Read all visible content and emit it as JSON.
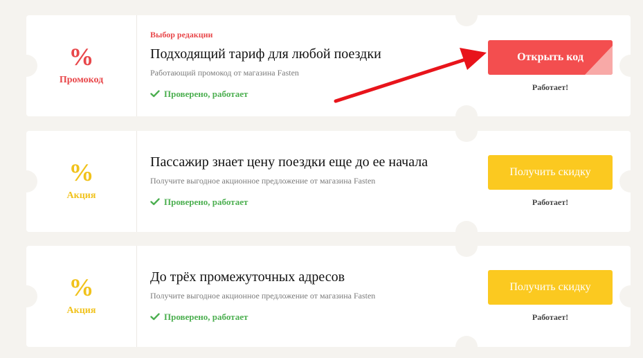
{
  "coupons": [
    {
      "percent": "%",
      "type": "Промокод",
      "editor_label": "Выбор редакции",
      "title": "Подходящий тариф для любой поездки",
      "subtitle": "Работающий промокод от магазина Fasten",
      "verified": "Проверено, работает",
      "button": "Открыть код",
      "status": "Работает!"
    },
    {
      "percent": "%",
      "type": "Акция",
      "title": "Пассажир знает цену поездки еще до ее начала",
      "subtitle": "Получите выгодное акционное предложение от магазина Fasten",
      "verified": "Проверено, работает",
      "button": "Получить скидку",
      "status": "Работает!"
    },
    {
      "percent": "%",
      "type": "Акция",
      "title": "До трёх промежуточных адресов",
      "subtitle": "Получите выгодное акционное предложение от магазина Fasten",
      "verified": "Проверено, работает",
      "button": "Получить скидку",
      "status": "Работает!"
    }
  ],
  "colors": {
    "background": "#f5f3ef",
    "promo_red": "#e8474a",
    "button_red": "#f34e4f",
    "action_yellow": "#f1c21b",
    "button_yellow": "#fbc920",
    "verified_green": "#4caf50",
    "arrow_red": "#e8141b"
  },
  "icons": {
    "verified": "checkmark-icon",
    "annotation": "red-arrow"
  }
}
